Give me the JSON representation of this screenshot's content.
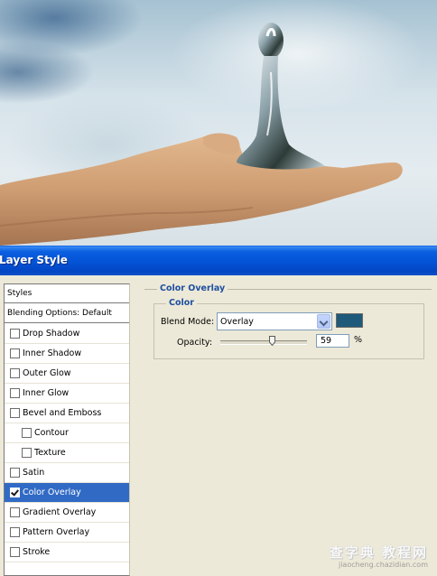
{
  "window": {
    "title": "Layer Style"
  },
  "styles_panel": {
    "header": "Styles",
    "blending_options": "Blending Options: Default",
    "items": [
      {
        "label": "Drop Shadow",
        "checked": false,
        "selected": false,
        "indent": false
      },
      {
        "label": "Inner Shadow",
        "checked": false,
        "selected": false,
        "indent": false
      },
      {
        "label": "Outer Glow",
        "checked": false,
        "selected": false,
        "indent": false
      },
      {
        "label": "Inner Glow",
        "checked": false,
        "selected": false,
        "indent": false
      },
      {
        "label": "Bevel and Emboss",
        "checked": false,
        "selected": false,
        "indent": false
      },
      {
        "label": "Contour",
        "checked": false,
        "selected": false,
        "indent": true
      },
      {
        "label": "Texture",
        "checked": false,
        "selected": false,
        "indent": true
      },
      {
        "label": "Satin",
        "checked": false,
        "selected": false,
        "indent": false
      },
      {
        "label": "Color Overlay",
        "checked": true,
        "selected": true,
        "indent": false
      },
      {
        "label": "Gradient Overlay",
        "checked": false,
        "selected": false,
        "indent": false
      },
      {
        "label": "Pattern Overlay",
        "checked": false,
        "selected": false,
        "indent": false
      },
      {
        "label": "Stroke",
        "checked": false,
        "selected": false,
        "indent": false
      }
    ]
  },
  "color_overlay": {
    "section_title": "Color Overlay",
    "group_title": "Color",
    "blend_mode_label": "Blend Mode:",
    "blend_mode_value": "Overlay",
    "color": "#1f5a7a",
    "opacity_label": "Opacity:",
    "opacity_value": "59",
    "opacity_unit": "%",
    "opacity_fraction": 0.59
  },
  "watermark": {
    "line1": "查字典 教程网",
    "line2": "jiaocheng.chazidian.com"
  },
  "colors": {
    "title_bar": "#0453d6",
    "selection": "#316ac5",
    "group_title": "#1f4fa0",
    "dialog_bg": "#ece9d8"
  }
}
